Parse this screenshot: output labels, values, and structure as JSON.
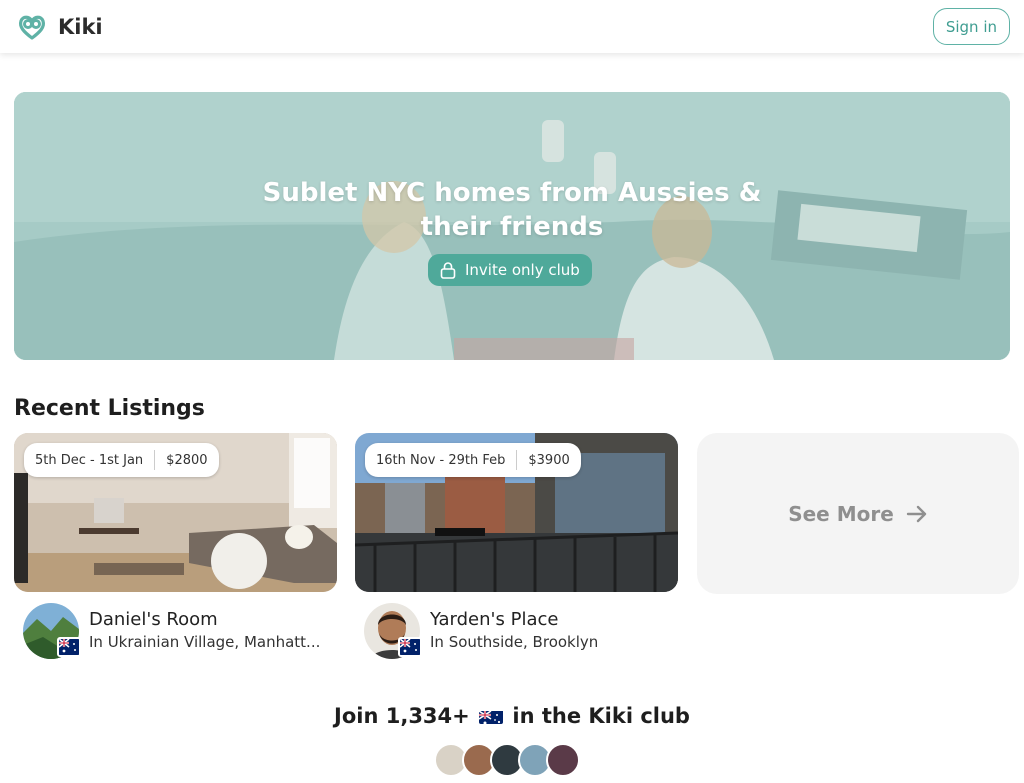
{
  "header": {
    "brand_name": "Kiki",
    "signin_label": "Sign in",
    "logo_icon": "pretzel-heart-icon",
    "accent_color": "#5fb2a6"
  },
  "hero": {
    "title_line1": "Sublet NYC homes from Aussies &",
    "title_line2": "their friends",
    "badge_label": "Invite only club",
    "badge_icon": "lock-icon"
  },
  "recent": {
    "title": "Recent Listings",
    "listings": [
      {
        "dates": "5th Dec - 1st Jan",
        "price": "$2800",
        "name": "Daniel's Room",
        "location": "In Ukrainian Village, Manhatt..."
      },
      {
        "dates": "16th Nov - 29th Feb",
        "price": "$3900",
        "name": "Yarden's Place",
        "location": "In Southside, Brooklyn"
      }
    ],
    "see_more_label": "See More",
    "see_more_icon": "arrow-right-icon"
  },
  "join": {
    "prefix": "Join 1,334+",
    "suffix": "in the Kiki club",
    "flag_icon": "australia-flag-icon"
  }
}
